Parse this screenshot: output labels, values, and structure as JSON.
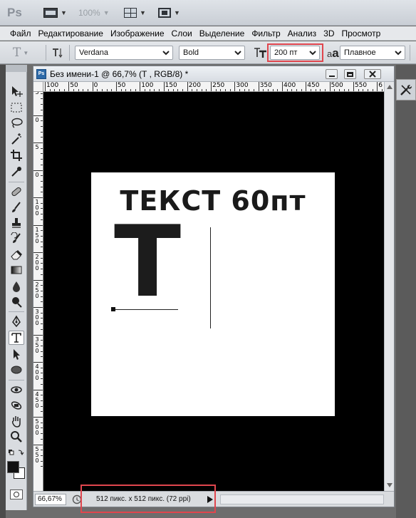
{
  "app": {
    "logo": "Ps",
    "zoom_display": "100%"
  },
  "menu": [
    "Файл",
    "Редактирование",
    "Изображение",
    "Слои",
    "Выделение",
    "Фильтр",
    "Анализ",
    "3D",
    "Просмотр"
  ],
  "options": {
    "tool_letter": "T",
    "font_family": "Verdana",
    "font_style": "Bold",
    "font_size": "200 пт",
    "aa_label": "a",
    "aa_sub": "a",
    "antialias": "Плавное"
  },
  "document": {
    "badge": "Ps",
    "title": "Без имени-1 @ 66,7% (Т , RGB/8) *",
    "canvas_heading": "ТЕКСТ 60пт",
    "big_glyph": "Т",
    "zoom_field": "66,67%",
    "status": "512 пикс. x 512 пикс. (72 ppi)"
  },
  "ruler": {
    "h_labels": [
      "100",
      "50",
      "0",
      "50",
      "100",
      "150",
      "200",
      "250",
      "300",
      "350",
      "400",
      "450",
      "500",
      "550",
      "6"
    ],
    "v_labels": [
      "5",
      "0",
      "5",
      "0",
      "1 0 0",
      "1 5 0",
      "2 0 0",
      "2 5 0",
      "3 0 0",
      "3 5 0",
      "4 0 0",
      "4 5 0",
      "5 0 0",
      "5 5 0"
    ]
  },
  "colors": {
    "highlight": "#e0464e",
    "canvas_bg": "#000000",
    "artboard": "#ffffff"
  }
}
